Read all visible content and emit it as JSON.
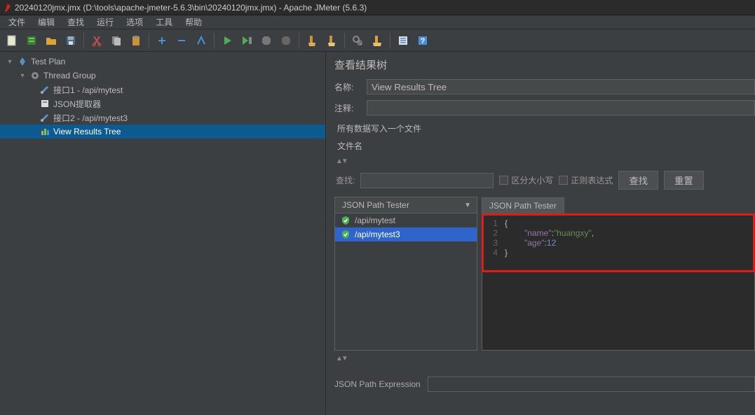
{
  "window": {
    "title": "20240120jmx.jmx (D:\\tools\\apache-jmeter-5.6.3\\bin\\20240120jmx.jmx) - Apache JMeter (5.6.3)"
  },
  "menu": {
    "file": "文件",
    "edit": "编辑",
    "search": "查找",
    "run": "运行",
    "options": "选项",
    "tools": "工具",
    "help": "帮助"
  },
  "tree": {
    "root": "Test Plan",
    "group": "Thread Group",
    "items": [
      "接口1 - /api/mytest",
      "JSON提取器",
      "接口2 - /api/mytest3",
      "View Results Tree"
    ]
  },
  "panel": {
    "title": "查看结果树",
    "name_label": "名称:",
    "name_value": "View Results Tree",
    "comment_label": "注释:",
    "write_all_label": "所有数据写入一个文件",
    "filename_label": "文件名",
    "search_label": "查找:",
    "case_label": "区分大小写",
    "regex_label": "正则表达式",
    "search_btn": "查找",
    "reset_btn": "重置"
  },
  "results": {
    "renderer": "JSON Path Tester",
    "samples": [
      "/api/mytest",
      "/api/mytest3"
    ],
    "tab": "JSON Path Tester",
    "editor": {
      "l1": "{",
      "l2_key": "\"name\"",
      "l2_sep": ": ",
      "l2_val": "\"huangxy\"",
      "l2_end": ",",
      "l3_key": "\"age\"",
      "l3_sep": ": ",
      "l3_val": "12",
      "l4": "}"
    },
    "expr_label": "JSON Path Expression"
  }
}
